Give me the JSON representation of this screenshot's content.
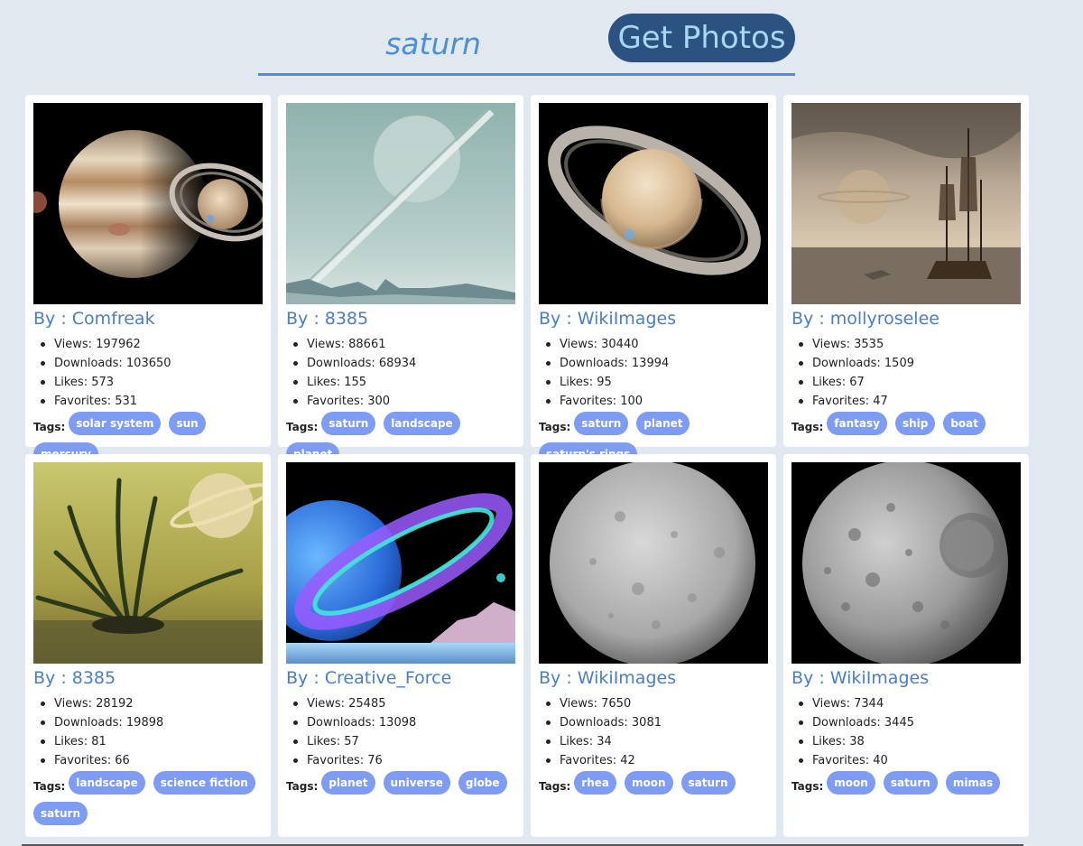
{
  "search": {
    "value": "saturn",
    "button_label": "Get Photos"
  },
  "tags_label": "Tags:",
  "cards": [
    {
      "author": "By : Comfreak",
      "views": "Views: 197962",
      "downloads": "Downloads: 103650",
      "likes": "Likes: 573",
      "favorites": "Favorites: 531",
      "tags": [
        "solar system",
        "sun",
        "mercury"
      ]
    },
    {
      "author": "By : 8385",
      "views": "Views: 88661",
      "downloads": "Downloads: 68934",
      "likes": "Likes: 155",
      "favorites": "Favorites: 300",
      "tags": [
        "saturn",
        "landscape",
        "planet"
      ]
    },
    {
      "author": "By : WikiImages",
      "views": "Views: 30440",
      "downloads": "Downloads: 13994",
      "likes": "Likes: 95",
      "favorites": "Favorites: 100",
      "tags": [
        "saturn",
        "planet",
        "saturn's rings"
      ]
    },
    {
      "author": "By : mollyroselee",
      "views": "Views: 3535",
      "downloads": "Downloads: 1509",
      "likes": "Likes: 67",
      "favorites": "Favorites: 47",
      "tags": [
        "fantasy",
        "ship",
        "boat"
      ]
    },
    {
      "author": "By : 8385",
      "views": "Views: 28192",
      "downloads": "Downloads: 19898",
      "likes": "Likes: 81",
      "favorites": "Favorites: 66",
      "tags": [
        "landscape",
        "science fiction",
        "saturn"
      ]
    },
    {
      "author": "By : Creative_Force",
      "views": "Views: 25485",
      "downloads": "Downloads: 13098",
      "likes": "Likes: 57",
      "favorites": "Favorites: 76",
      "tags": [
        "planet",
        "universe",
        "globe"
      ]
    },
    {
      "author": "By : WikiImages",
      "views": "Views: 7650",
      "downloads": "Downloads: 3081",
      "likes": "Likes: 34",
      "favorites": "Favorites: 42",
      "tags": [
        "rhea",
        "moon",
        "saturn"
      ]
    },
    {
      "author": "By : WikiImages",
      "views": "Views: 7344",
      "downloads": "Downloads: 3445",
      "likes": "Likes: 38",
      "favorites": "Favorites: 40",
      "tags": [
        "moon",
        "saturn",
        "mimas"
      ]
    }
  ]
}
